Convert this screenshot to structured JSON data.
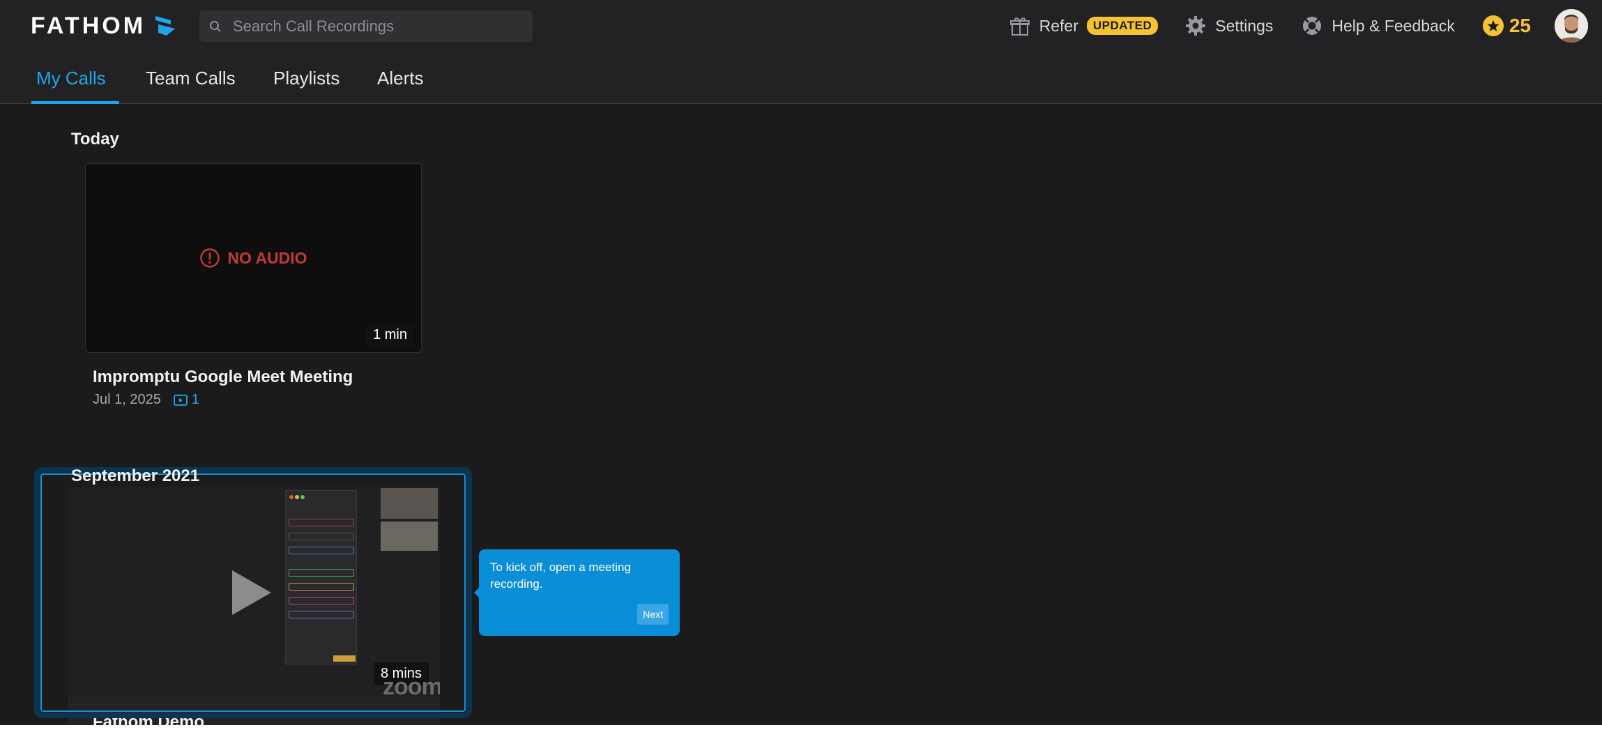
{
  "header": {
    "logo_text": "FATHOM",
    "search_placeholder": "Search Call Recordings",
    "refer_label": "Refer",
    "refer_badge": "UPDATED",
    "settings_label": "Settings",
    "help_label": "Help & Feedback",
    "points": "25",
    "accent_color": "#1ea7e8",
    "badge_color": "#f5c331"
  },
  "tabs": [
    {
      "label": "My Calls",
      "active": true
    },
    {
      "label": "Team Calls",
      "active": false
    },
    {
      "label": "Playlists",
      "active": false
    },
    {
      "label": "Alerts",
      "active": false
    }
  ],
  "sections": [
    {
      "title": "Today",
      "calls": [
        {
          "overlay": "NO AUDIO",
          "duration": "1 min",
          "title": "Impromptu Google Meet Meeting",
          "date": "Jul 1, 2025",
          "clips": "1"
        }
      ]
    },
    {
      "title": "September 2021",
      "calls": [
        {
          "duration": "8 mins",
          "title": "Fathom Demo",
          "thumbnail_brand": "zoom"
        }
      ]
    }
  ],
  "onboarding_tooltip": {
    "text": "To kick off, open a meeting recording.",
    "next_label": "Next"
  }
}
